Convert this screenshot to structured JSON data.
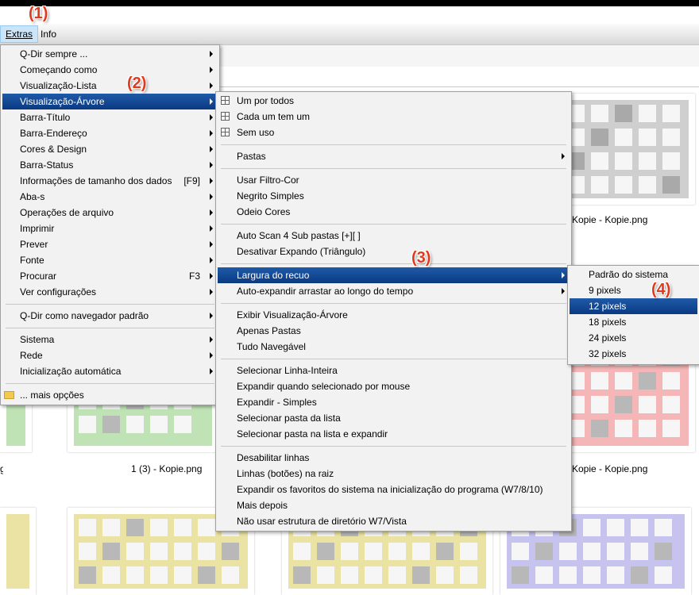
{
  "menubar": {
    "extras": "Extras",
    "info": "Info"
  },
  "annotations": [
    "(1)",
    "(2)",
    "(3)",
    "(4)"
  ],
  "thumb_labels": [
    "Kopie - Kopie.png",
    "Kopie - Kopie.png",
    "1 (3) - Kopie.png"
  ],
  "main_menu": [
    {
      "label": "Q-Dir sempre ...",
      "arrow": true
    },
    {
      "label": "Começando como",
      "arrow": true
    },
    {
      "label": "Visualização-Lista",
      "arrow": true
    },
    {
      "label": "Visualização-Árvore",
      "arrow": true,
      "highlighted": true
    },
    {
      "label": "Barra-Título",
      "arrow": true
    },
    {
      "label": "Barra-Endereço",
      "arrow": true
    },
    {
      "label": "Cores & Design",
      "arrow": true
    },
    {
      "label": "Barra-Status",
      "arrow": true
    },
    {
      "label": "Informações de tamanho dos dados",
      "shortcut": "[F9]",
      "arrow": true
    },
    {
      "label": "Aba-s",
      "arrow": true
    },
    {
      "label": "Operações de arquivo",
      "arrow": true
    },
    {
      "label": "Imprimir",
      "arrow": true
    },
    {
      "label": "Prever",
      "arrow": true
    },
    {
      "label": "Fonte",
      "arrow": true
    },
    {
      "label": "Procurar",
      "shortcut": "F3",
      "arrow": true
    },
    {
      "label": "Ver configurações",
      "arrow": true
    },
    {
      "separator": true
    },
    {
      "label": "Q-Dir como navegador padrão",
      "arrow": true
    },
    {
      "separator": true
    },
    {
      "label": "Sistema",
      "arrow": true
    },
    {
      "label": "Rede",
      "arrow": true
    },
    {
      "label": "Inicialização automática",
      "arrow": true
    },
    {
      "separator": true
    },
    {
      "label": "... mais opções",
      "icon": "folder-icon"
    }
  ],
  "tree_menu": [
    {
      "label": "Um por todos",
      "icon": "radio-icon"
    },
    {
      "label": "Cada um tem um",
      "icon": "radio-icon"
    },
    {
      "label": "Sem uso",
      "icon": "radio-icon"
    },
    {
      "separator": true
    },
    {
      "label": "Pastas",
      "arrow": true
    },
    {
      "separator": true
    },
    {
      "label": "Usar Filtro-Cor"
    },
    {
      "label": "Negrito Simples"
    },
    {
      "label": "Odeio Cores"
    },
    {
      "separator": true
    },
    {
      "label": "Auto Scan 4 Sub pastas [+][ ]"
    },
    {
      "label": "Desativar Expando (Triângulo)"
    },
    {
      "separator": true
    },
    {
      "label": "Largura do recuo",
      "arrow": true,
      "highlighted": true
    },
    {
      "label": "Auto-expandir arrastar ao longo do tempo",
      "arrow": true
    },
    {
      "separator": true
    },
    {
      "label": "Exibir Visualização-Árvore"
    },
    {
      "label": "Apenas Pastas"
    },
    {
      "label": "Tudo Navegável"
    },
    {
      "separator": true
    },
    {
      "label": "Selecionar Linha-Inteira"
    },
    {
      "label": "Expandir quando selecionado por mouse"
    },
    {
      "label": "Expandir - Simples"
    },
    {
      "label": "Selecionar pasta da lista"
    },
    {
      "label": "Selecionar pasta na lista e expandir"
    },
    {
      "separator": true
    },
    {
      "label": "Desabilitar linhas"
    },
    {
      "label": "Linhas (botões) na raiz"
    },
    {
      "label": "Expandir os favoritos do sistema na inicialização do programa (W7/8/10)"
    },
    {
      "label": "Mais depois"
    },
    {
      "label": "Não usar estrutura de diretório W7/Vista"
    }
  ],
  "indent_menu": [
    {
      "label": "Padrão do sistema"
    },
    {
      "label": "9 pixels"
    },
    {
      "label": "12 pixels",
      "selected": true
    },
    {
      "label": "18 pixels"
    },
    {
      "label": "24 pixels"
    },
    {
      "label": "32 pixels"
    }
  ],
  "colors": {
    "highlight": "#0b3a82",
    "annotation": "#e03a1e"
  }
}
